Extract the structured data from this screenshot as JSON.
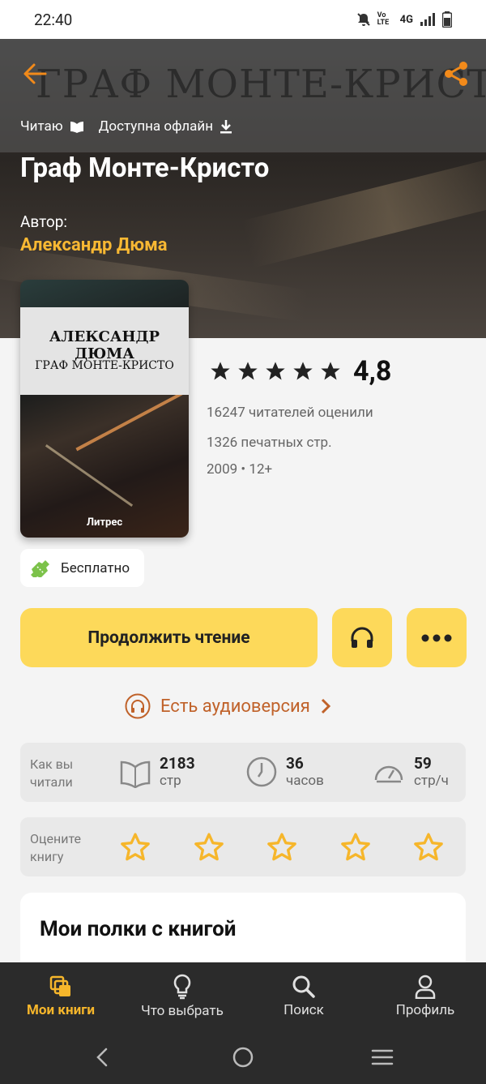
{
  "status": {
    "time": "22:40",
    "net": "4G",
    "volte": "Vo LTE"
  },
  "hero": {
    "bg_title": "ГРАФ МОНТЕ-КРИСТО",
    "tags": [
      "Читаю",
      "Доступна офлайн"
    ],
    "title": "Граф Монте-Кристо",
    "author_label": "Автор:",
    "author": "Александр Дюма"
  },
  "cover": {
    "author": "АЛЕКСАНДР ДЮМА",
    "title": "ГРАФ МОНТЕ-КРИСТО",
    "publisher": "Литрес"
  },
  "rating": {
    "value": "4,8",
    "stars": 5
  },
  "meta": {
    "ratings_count": "16247 читателей оценили",
    "pages": "1326 печатных стр.",
    "year_age": "2009 • 12+"
  },
  "price": {
    "label": "Бесплатно"
  },
  "actions": {
    "continue": "Продолжить чтение"
  },
  "audio": {
    "label": "Есть аудиоверсия"
  },
  "stats": {
    "label": "Как вы читали",
    "items": [
      {
        "num": "2183",
        "unit": "стр"
      },
      {
        "num": "36",
        "unit": "часов"
      },
      {
        "num": "59",
        "unit": "стр/ч"
      }
    ]
  },
  "rate": {
    "label": "Оцените книгу"
  },
  "shelves": {
    "heading": "Мои полки с книгой"
  },
  "tabs": [
    {
      "label": "Мои книги"
    },
    {
      "label": "Что выбрать"
    },
    {
      "label": "Поиск"
    },
    {
      "label": "Профиль"
    }
  ],
  "colors": {
    "accent": "#fdd95a",
    "orange": "#f6b62b",
    "link": "#c0622a",
    "tabbar": "#2b2b2b"
  }
}
